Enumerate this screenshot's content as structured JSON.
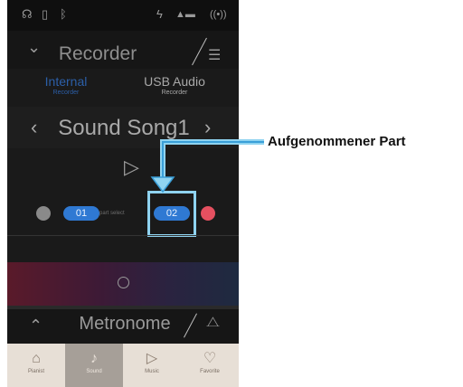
{
  "status_bar": {
    "icons": [
      "headphones-icon",
      "usb-memory-icon",
      "bluetooth-icon",
      "power-icon",
      "wifi-midi-icon",
      "broadcast-icon"
    ]
  },
  "header": {
    "title": "Recorder"
  },
  "tabs": [
    {
      "label": "Internal",
      "sublabel": "Recorder",
      "active": true
    },
    {
      "label": "USB Audio",
      "sublabel": "Recorder",
      "active": false
    }
  ],
  "song": {
    "name": "Sound Song1"
  },
  "parts": {
    "part1": "01",
    "part2": "02",
    "separator": "part select"
  },
  "metronome": {
    "title": "Metronome"
  },
  "nav": [
    {
      "label": "Pianist",
      "icon": "piano-icon"
    },
    {
      "label": "Sound",
      "icon": "note-icon",
      "selected": true
    },
    {
      "label": "Music",
      "icon": "play-icon"
    },
    {
      "label": "Favorite",
      "icon": "heart-icon"
    }
  ],
  "callout": {
    "text": "Aufgenommener Part"
  },
  "colors": {
    "accent_blue": "#2f79d3",
    "highlight": "#8fd3f0",
    "record_red": "#e55060"
  }
}
